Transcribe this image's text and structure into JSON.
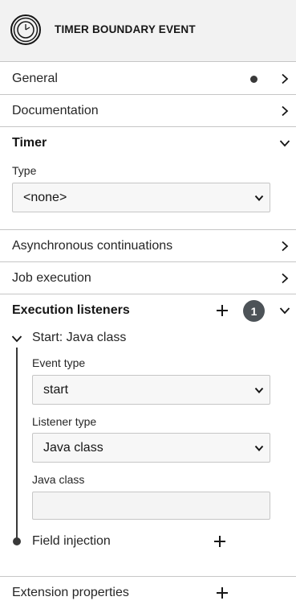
{
  "header": {
    "title": "TIMER BOUNDARY EVENT",
    "icon": "timer-boundary-event-icon"
  },
  "groups": {
    "general": {
      "label": "General",
      "has_entries": true
    },
    "documentation": {
      "label": "Documentation"
    },
    "timer": {
      "label": "Timer",
      "type_label": "Type",
      "type_value": "<none>",
      "type_options": [
        "<none>"
      ]
    },
    "async": {
      "label": "Asynchronous continuations"
    },
    "job": {
      "label": "Job execution"
    },
    "listeners": {
      "label": "Execution listeners",
      "count": "1",
      "item": {
        "title": "Start: Java class",
        "event_type_label": "Event type",
        "event_type_value": "start",
        "listener_type_label": "Listener type",
        "listener_type_value": "Java class",
        "java_class_label": "Java class",
        "java_class_value": "",
        "field_injection_label": "Field injection"
      }
    },
    "extension": {
      "label": "Extension properties"
    }
  },
  "colors": {
    "header_bg": "#f2f2f2",
    "border": "#c6c6c6",
    "badge_bg": "#4d5358",
    "text": "#161616"
  }
}
